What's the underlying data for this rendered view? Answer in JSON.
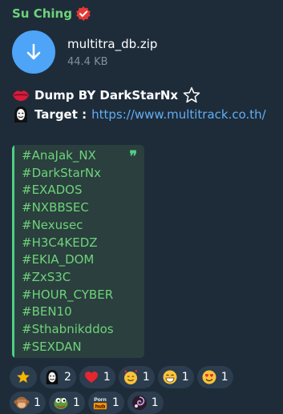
{
  "sender": {
    "name": "Su Ching",
    "verified_icon": "verified-badge-icon",
    "name_color": "#6fd37a"
  },
  "file": {
    "name": "multitra_db.zip",
    "size": "44.4 KB",
    "icon": "download-arrow-icon",
    "icon_color": "#4ea4f6"
  },
  "message": {
    "line1_icon": "lips-icon",
    "line1_text": "Dump BY DarkStarNx",
    "line1_trailing_icon": "star-outline-icon",
    "line2_icon": "hacker-mask-icon",
    "line2_label": "Target :",
    "line2_link": "https://www.multitrack.co.th/"
  },
  "quote": {
    "mark": "❞",
    "hashtags": [
      "#AnaJak_NX",
      "#DarkStarNx",
      "#EXADOS",
      "#NXBBSEC",
      "#Nexusec",
      "#H3C4KEDZ",
      "#EKIA_DOM",
      "#ZxS3C",
      "#HOUR_CYBER",
      "#BEN10",
      "#Sthabnikddos",
      "#SEXDAN"
    ],
    "accent_color": "#4fcf84"
  },
  "reactions": {
    "row1": [
      {
        "icon": "star-icon",
        "count": ""
      },
      {
        "icon": "hacker-mask-icon",
        "count": "2"
      },
      {
        "icon": "red-heart-icon",
        "count": "1"
      },
      {
        "icon": "smiling-face-with-hearts-icon",
        "count": "1"
      },
      {
        "icon": "grinning-face-icon",
        "count": "1"
      },
      {
        "icon": "heart-eyes-face-icon",
        "count": "1"
      }
    ],
    "row2": [
      {
        "icon": "see-no-evil-monkey-icon",
        "count": "1"
      },
      {
        "icon": "pepe-frog-icon",
        "count": "1"
      },
      {
        "icon": "pornhub-logo-icon",
        "count": "1",
        "logo_text_1": "Porn",
        "logo_text_2": "hub"
      },
      {
        "icon": "swirl-avatar-icon",
        "count": "1"
      }
    ]
  }
}
